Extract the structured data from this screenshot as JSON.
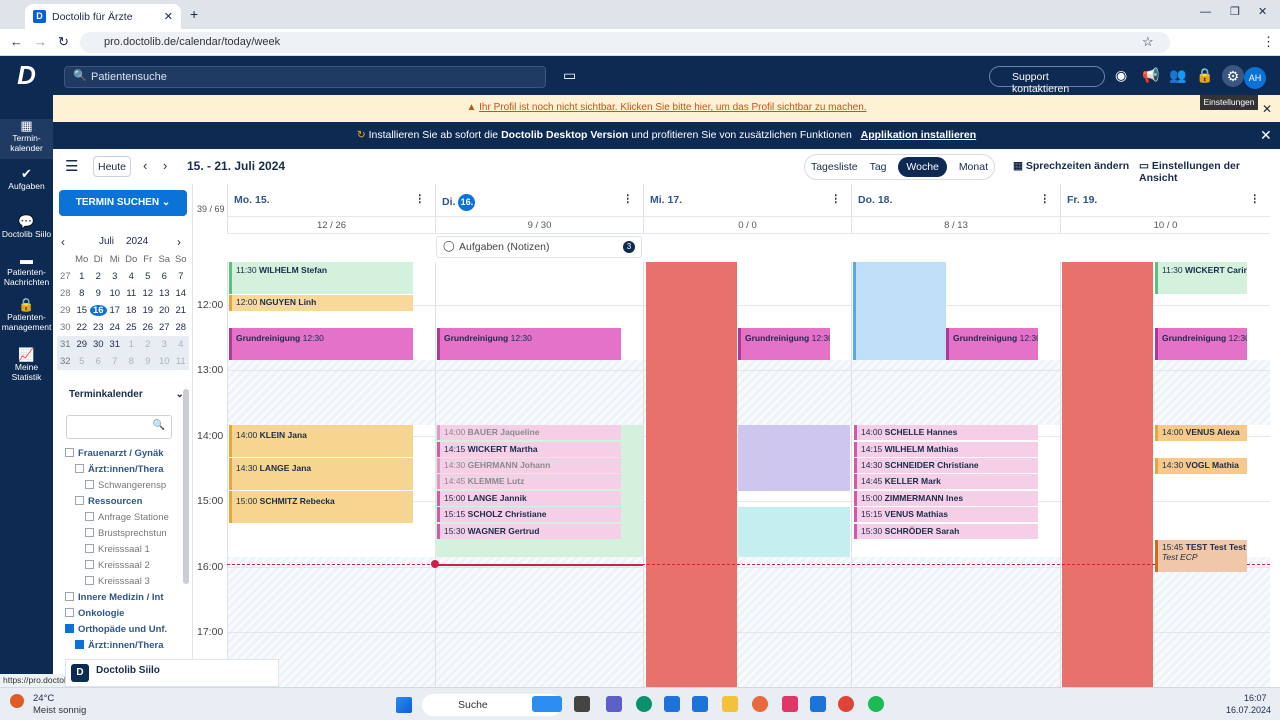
{
  "browser": {
    "tab_title": "Doctolib für Ärzte",
    "url": "pro.doctolib.de/calendar/today/week"
  },
  "header": {
    "search_placeholder": "Patientensuche",
    "support": "Support kontaktieren",
    "avatar": "AH",
    "badge_news": "34",
    "tooltip": "Einstellungen"
  },
  "sidebar": [
    {
      "label": "Termin-\nkalender",
      "icon": "calendar-icon"
    },
    {
      "label": "Aufgaben",
      "icon": "tasks-icon",
      "badge": "4"
    },
    {
      "label": "Doctolib Siilo",
      "icon": "chat-icon"
    },
    {
      "label": "Patienten-\nNachrichten",
      "icon": "message-icon"
    },
    {
      "label": "Patienten-\nmanagement",
      "icon": "patient-icon",
      "badge": "1"
    },
    {
      "label": "Meine Statistik",
      "icon": "stats-icon"
    }
  ],
  "warning": "Ihr Profil ist noch nicht sichtbar. Klicken Sie bitte hier, um das Profil sichtbar zu machen.",
  "install": {
    "text_pre": "Installieren Sie ab sofort die ",
    "text_bold": "Doctolib Desktop Version",
    "text_post": " und profitieren Sie von zusätzlichen Funktionen",
    "link": "Applikation installieren"
  },
  "toolbar": {
    "today": "Heute",
    "range": "15. - 21. Juli 2024",
    "views": [
      "Tagesliste",
      "Tag",
      "Woche",
      "Monat"
    ],
    "active_view": "Woche",
    "sprechzeiten": "Sprechzeiten ändern",
    "einstellungen": "Einstellungen der Ansicht"
  },
  "left": {
    "terminsuchen": "TERMIN SUCHEN",
    "month": "Juli",
    "year": "2024",
    "weekdays": [
      "Mo",
      "Di",
      "Mi",
      "Do",
      "Fr",
      "Sa",
      "So"
    ],
    "weeks": [
      [
        "27",
        "1",
        "2",
        "3",
        "4",
        "5",
        "6",
        "7"
      ],
      [
        "28",
        "8",
        "9",
        "10",
        "11",
        "12",
        "13",
        "14"
      ],
      [
        "29",
        "15",
        "16",
        "17",
        "18",
        "19",
        "20",
        "21"
      ],
      [
        "30",
        "22",
        "23",
        "24",
        "25",
        "26",
        "27",
        "28"
      ],
      [
        "31",
        "29",
        "30",
        "31",
        "1",
        "2",
        "3",
        "4"
      ],
      [
        "32",
        "5",
        "6",
        "7",
        "8",
        "9",
        "10",
        "11"
      ]
    ],
    "terminkalender": "Terminkalender",
    "tree": [
      "Frauenarzt / Gynäk",
      "Ärzt:innen/Thera",
      "Schwangerensp",
      "Ressourcen",
      "Anfrage Statione",
      "Brustsprechstun",
      "Kreisssaal 1",
      "Kreisssaal 2",
      "Kreisssaal 3",
      "Innere Medizin / Int",
      "Onkologie",
      "Orthopäde und Unf.",
      "Ärzt:innen/Thera"
    ],
    "siilo": "Doctolib Siilo"
  },
  "calendar": {
    "total": "39 / 69",
    "days": [
      {
        "label": "Mo. 15.",
        "count": "12 / 26"
      },
      {
        "label": "Di. ",
        "num": "16.",
        "count": "9 / 30"
      },
      {
        "label": "Mi. 17.",
        "count": "0 / 0"
      },
      {
        "label": "Do. 18.",
        "count": "8 / 13"
      },
      {
        "label": "Fr. 19.",
        "count": "10 / 0"
      }
    ],
    "tasks": "Aufgaben (Notizen)",
    "tasks_count": "3",
    "times": [
      "12:00",
      "13:00",
      "14:00",
      "15:00",
      "16:00",
      "17:00"
    ]
  },
  "events": {
    "mo": [
      {
        "t": "11:30",
        "n": "WILHELM Stefan"
      },
      {
        "t": "12:00",
        "n": "NGUYEN Linh"
      },
      {
        "t": "Grundreinigung",
        "n": "12:30"
      },
      {
        "t": "14:00",
        "n": "KLEIN Jana"
      },
      {
        "t": "14:30",
        "n": "LANGE Jana"
      },
      {
        "t": "15:00",
        "n": "SCHMITZ Rebecka"
      }
    ],
    "di": [
      {
        "t": "Grundreinigung",
        "n": "12:30"
      },
      {
        "t": "14:00",
        "n": "BAUER Jaqueline"
      },
      {
        "t": "14:15",
        "n": "WICKERT Martha"
      },
      {
        "t": "14:30",
        "n": "GEHRMANN Johann"
      },
      {
        "t": "14:45",
        "n": "KLEMME Lutz"
      },
      {
        "t": "15:00",
        "n": "LANGE Jannik"
      },
      {
        "t": "15:15",
        "n": "SCHOLZ Christiane"
      },
      {
        "t": "15:30",
        "n": "WAGNER Gertrud"
      }
    ],
    "mi": [
      {
        "t": "Grundreinigung",
        "n": "12:30"
      }
    ],
    "do": [
      {
        "t": "Grundreinigung",
        "n": "12:30"
      },
      {
        "t": "14:00",
        "n": "SCHELLE Hannes"
      },
      {
        "t": "14:15",
        "n": "WILHELM Mathias"
      },
      {
        "t": "14:30",
        "n": "SCHNEIDER Christiane"
      },
      {
        "t": "14:45",
        "n": "KELLER Mark"
      },
      {
        "t": "15:00",
        "n": "ZIMMERMANN Ines"
      },
      {
        "t": "15:15",
        "n": "VENUS Mathias"
      },
      {
        "t": "15:30",
        "n": "SCHRÖDER Sarah"
      }
    ],
    "fr": [
      {
        "t": "11:30",
        "n": "WICKERT Carin"
      },
      {
        "t": "Grundreinigung",
        "n": "12:30"
      },
      {
        "t": "14:00",
        "n": "VENUS Alexa"
      },
      {
        "t": "14:30",
        "n": "VOGL Mathia"
      },
      {
        "t": "15:45",
        "n": "TEST Test Test",
        "sub": "Test ECP"
      }
    ]
  },
  "status_url": "https://pro.doctolib.de/configuration",
  "taskbar": {
    "temp": "24°C",
    "weather": "Meist sonnig",
    "search": "Suche",
    "time": "16:07",
    "date": "16.07.2024"
  },
  "colors": {
    "navy": "#0d2a52",
    "accent": "#0b73d8",
    "red_block": "#e8726b"
  }
}
